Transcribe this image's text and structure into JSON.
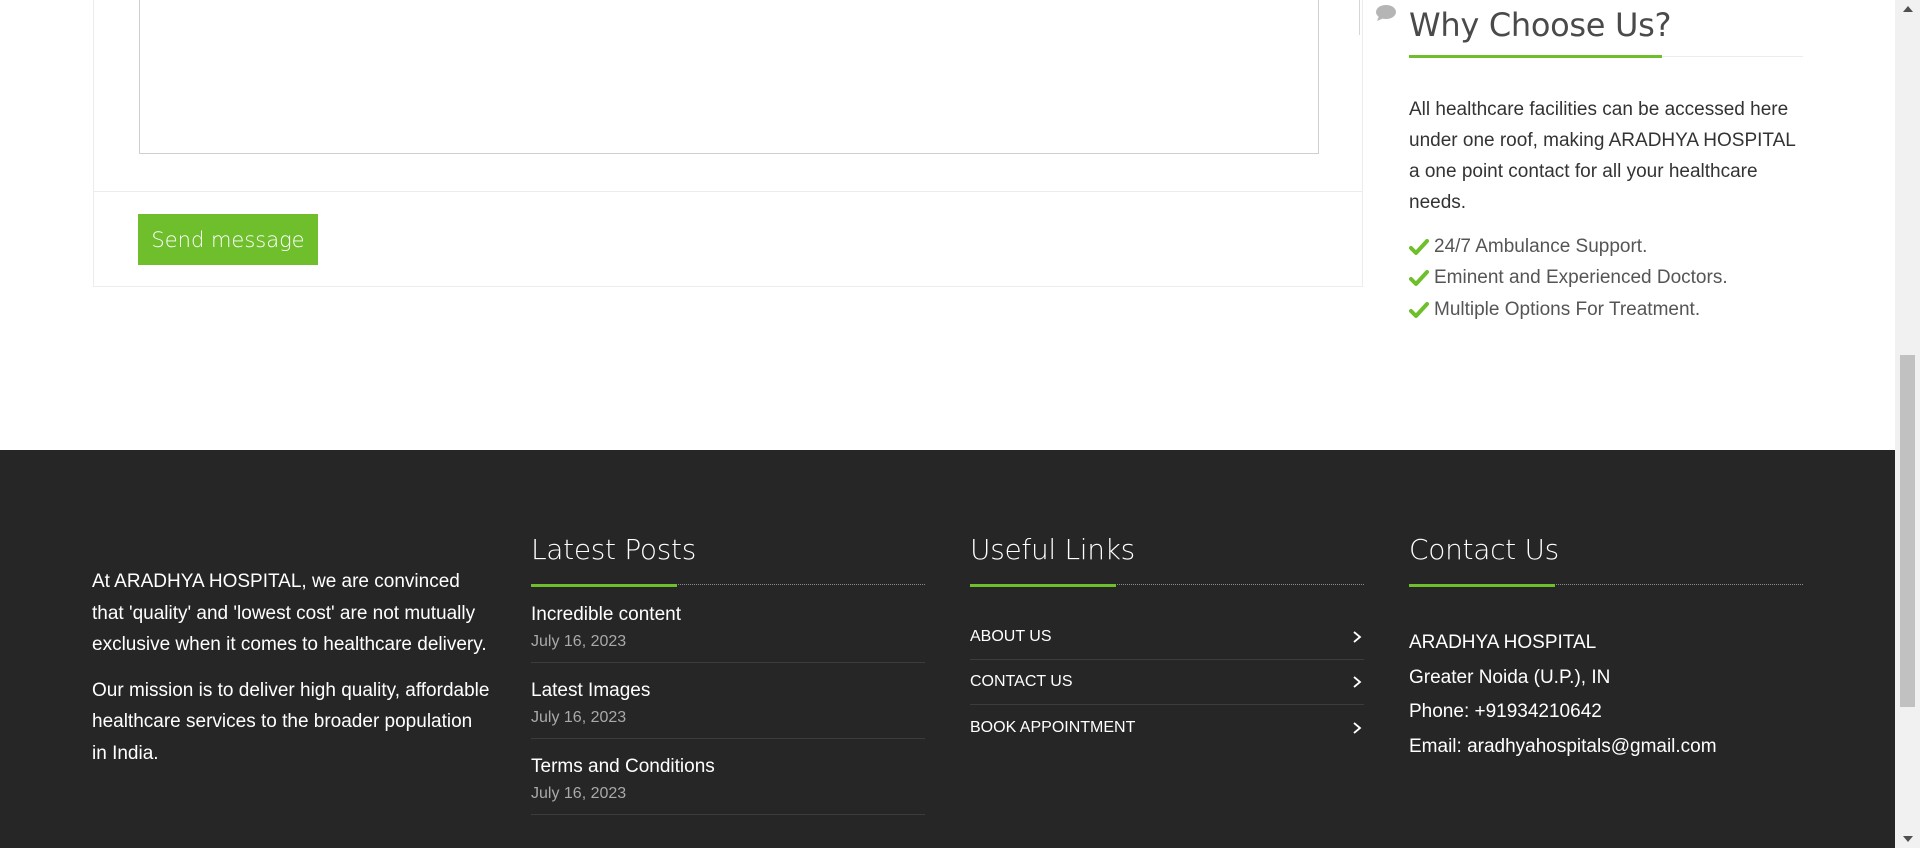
{
  "form": {
    "message_value": "",
    "send_label": "Send message"
  },
  "why": {
    "title": "Why Choose Us?",
    "description": "All healthcare facilities can be accessed here under one roof, making ARADHYA HOSPITAL a one point contact for all your healthcare needs.",
    "features": [
      "24/7 Ambulance Support.",
      "Eminent and Experienced Doctors.",
      "Multiple Options For Treatment."
    ]
  },
  "footer": {
    "about": [
      "At ARADHYA HOSPITAL, we are convinced that 'quality' and 'lowest cost' are not mutually exclusive when it comes to healthcare delivery.",
      "Our mission is to deliver high quality, affordable healthcare services to the broader population in India."
    ],
    "posts": {
      "title": "Latest Posts",
      "items": [
        {
          "title": "Incredible content",
          "date": "July 16, 2023"
        },
        {
          "title": "Latest Images",
          "date": "July 16, 2023"
        },
        {
          "title": "Terms and Conditions",
          "date": "July 16, 2023"
        }
      ]
    },
    "links": {
      "title": "Useful Links",
      "items": [
        "ABOUT US",
        "CONTACT US",
        "BOOK APPOINTMENT"
      ]
    },
    "contact": {
      "title": "Contact Us",
      "name": "ARADHYA HOSPITAL",
      "location": "Greater Noida (U.P.), IN",
      "phone": "Phone: +91934210642",
      "email": "Email: aradhyahospitals@gmail.com"
    }
  },
  "colors": {
    "accent": "#6fbf2c",
    "footer_bg": "#262626"
  },
  "icons": {
    "message": "comment-icon",
    "feature": "check-icon",
    "link": "chevron-right-icon"
  }
}
